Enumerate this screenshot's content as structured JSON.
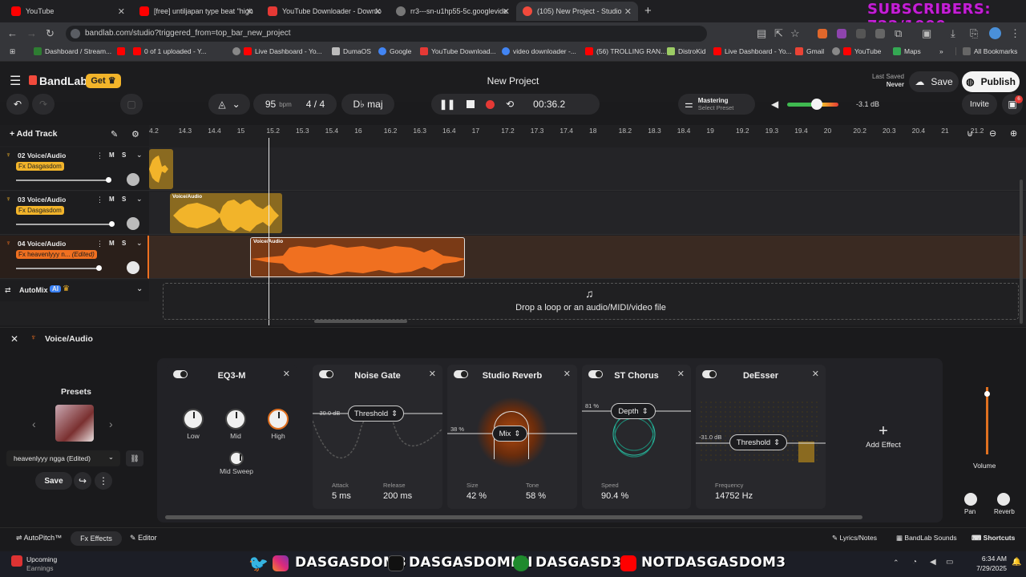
{
  "overlay": {
    "subscribers": "SUBSCRIBERS: 722/1000"
  },
  "tabs": [
    {
      "title": "YouTube",
      "color": "#ff0000",
      "active": false
    },
    {
      "title": "[free] untiljapan type beat \"high",
      "color": "#ff0000",
      "active": false
    },
    {
      "title": "YouTube Downloader - Downlo",
      "color": "#e53935",
      "active": false
    },
    {
      "title": "rr3---sn-u1hp55-5c.googlevide",
      "color": "#777777",
      "active": false
    },
    {
      "title": "(105) New Project - Studio",
      "color": "#f24a3c",
      "active": true
    }
  ],
  "address": {
    "url": "bandlab.com/studio?triggered_from=top_bar_new_project"
  },
  "bookmarks": [
    {
      "label": "Dashboard / Stream...",
      "color": "#2e7d32"
    },
    {
      "label": "",
      "color": "#ff0000"
    },
    {
      "label": "0 of 1 uploaded - Y...",
      "color": "#ff0000"
    },
    {
      "label": "Live Dashboard - Yo...",
      "color": "#ff0000"
    },
    {
      "label": "DumaOS",
      "color": "#bbbbbb"
    },
    {
      "label": "Google",
      "color": "#4285f4"
    },
    {
      "label": "YouTube Download...",
      "color": "#e53935"
    },
    {
      "label": "video downloader -...",
      "color": "#4285f4"
    },
    {
      "label": "(56) TROLLING RAN...",
      "color": "#ff0000"
    },
    {
      "label": "DistroKid",
      "color": "#9ccc65"
    },
    {
      "label": "Live Dashboard - Yo...",
      "color": "#ff0000"
    },
    {
      "label": "Gmail",
      "color": "#ea4335"
    },
    {
      "label": "YouTube",
      "color": "#ff0000"
    },
    {
      "label": "Maps",
      "color": "#34a853"
    }
  ],
  "all_bookmarks": "All Bookmarks",
  "app": {
    "brand": "BandLab",
    "get_label": "Get",
    "project_title": "New Project",
    "last_saved_label": "Last Saved",
    "last_saved_value": "Never",
    "save_label": "Save",
    "publish_label": "Publish",
    "invite_label": "Invite",
    "notif_count": "6"
  },
  "transport": {
    "bpm": "95",
    "bpm_unit": "bpm",
    "time_sig": "4 / 4",
    "key": "D♭ maj",
    "time": "00:36.2",
    "mastering_label": "Mastering",
    "mastering_preset": "Select Preset",
    "master_db": "-3.1 dB"
  },
  "timeline": {
    "add_track": "Add Track",
    "ticks": [
      "4.2",
      "14.3",
      "14.4",
      "15",
      "15.2",
      "15.3",
      "15.4",
      "16",
      "16.2",
      "16.3",
      "16.4",
      "17",
      "17.2",
      "17.3",
      "17.4",
      "18",
      "18.2",
      "18.3",
      "18.4",
      "19",
      "19.2",
      "19.3",
      "19.4",
      "20",
      "20.2",
      "20.3",
      "20.4",
      "21",
      "21.2"
    ]
  },
  "tracks": [
    {
      "name": "02 Voice/Audio",
      "fx": "Fx Dasgasdom",
      "edited": "",
      "clip_label": "",
      "color": "#f2b42a"
    },
    {
      "name": "03 Voice/Audio",
      "fx": "Fx Dasgasdom",
      "edited": "",
      "clip_label": "Voice/Audio",
      "color": "#f2b42a"
    },
    {
      "name": "04 Voice/Audio",
      "fx": "Fx heavenlyyy n...",
      "edited": "(Edited)",
      "clip_label": "Voice/Audio",
      "color": "#f07020"
    }
  ],
  "mute_label": "M",
  "solo_label": "S",
  "automix": {
    "label": "AutoMix",
    "badge": "AI"
  },
  "drop_zone": "Drop a loop or an audio/MIDI/video file",
  "panel": {
    "title": "Voice/Audio",
    "presets_label": "Presets",
    "preset_name": "heavenlyyy ngga (Edited)",
    "save_label": "Save",
    "add_effect": "Add Effect",
    "volume_label": "Volume",
    "pan_label": "Pan",
    "reverb_label": "Reverb"
  },
  "effects": {
    "eq": {
      "title": "EQ3-M",
      "low": "Low",
      "mid": "Mid",
      "high": "High",
      "sweep": "Mid Sweep"
    },
    "gate": {
      "title": "Noise Gate",
      "param": "Threshold",
      "db": "-30.0 dB",
      "attack_label": "Attack",
      "attack": "5 ms",
      "release_label": "Release",
      "release": "200 ms"
    },
    "reverb": {
      "title": "Studio Reverb",
      "param": "Mix",
      "pct": "38 %",
      "size_label": "Size",
      "size": "42 %",
      "tone_label": "Tone",
      "tone": "58 %"
    },
    "chorus": {
      "title": "ST Chorus",
      "param": "Depth",
      "pct": "81 %",
      "speed_label": "Speed",
      "speed": "90.4 %"
    },
    "deesser": {
      "title": "DeEsser",
      "param": "Threshold",
      "db": "-31.0 dB",
      "freq_label": "Frequency",
      "freq": "14752 Hz"
    }
  },
  "bottom": {
    "autopitch": "AutoPitch™",
    "effects": "Effects",
    "editor": "Editor",
    "lyrics": "Lyrics/Notes",
    "sounds": "BandLab Sounds",
    "shortcuts": "Shortcuts"
  },
  "taskbar": {
    "upcoming": "Upcoming",
    "earnings": "Earnings",
    "handle1": "DASGASDOM3",
    "handle2": "DASGASDOMINI",
    "handle3": "DASGASD3M",
    "handle4": "NOTDASGASDOM3",
    "time": "6:34 AM",
    "date": "7/29/2025"
  }
}
